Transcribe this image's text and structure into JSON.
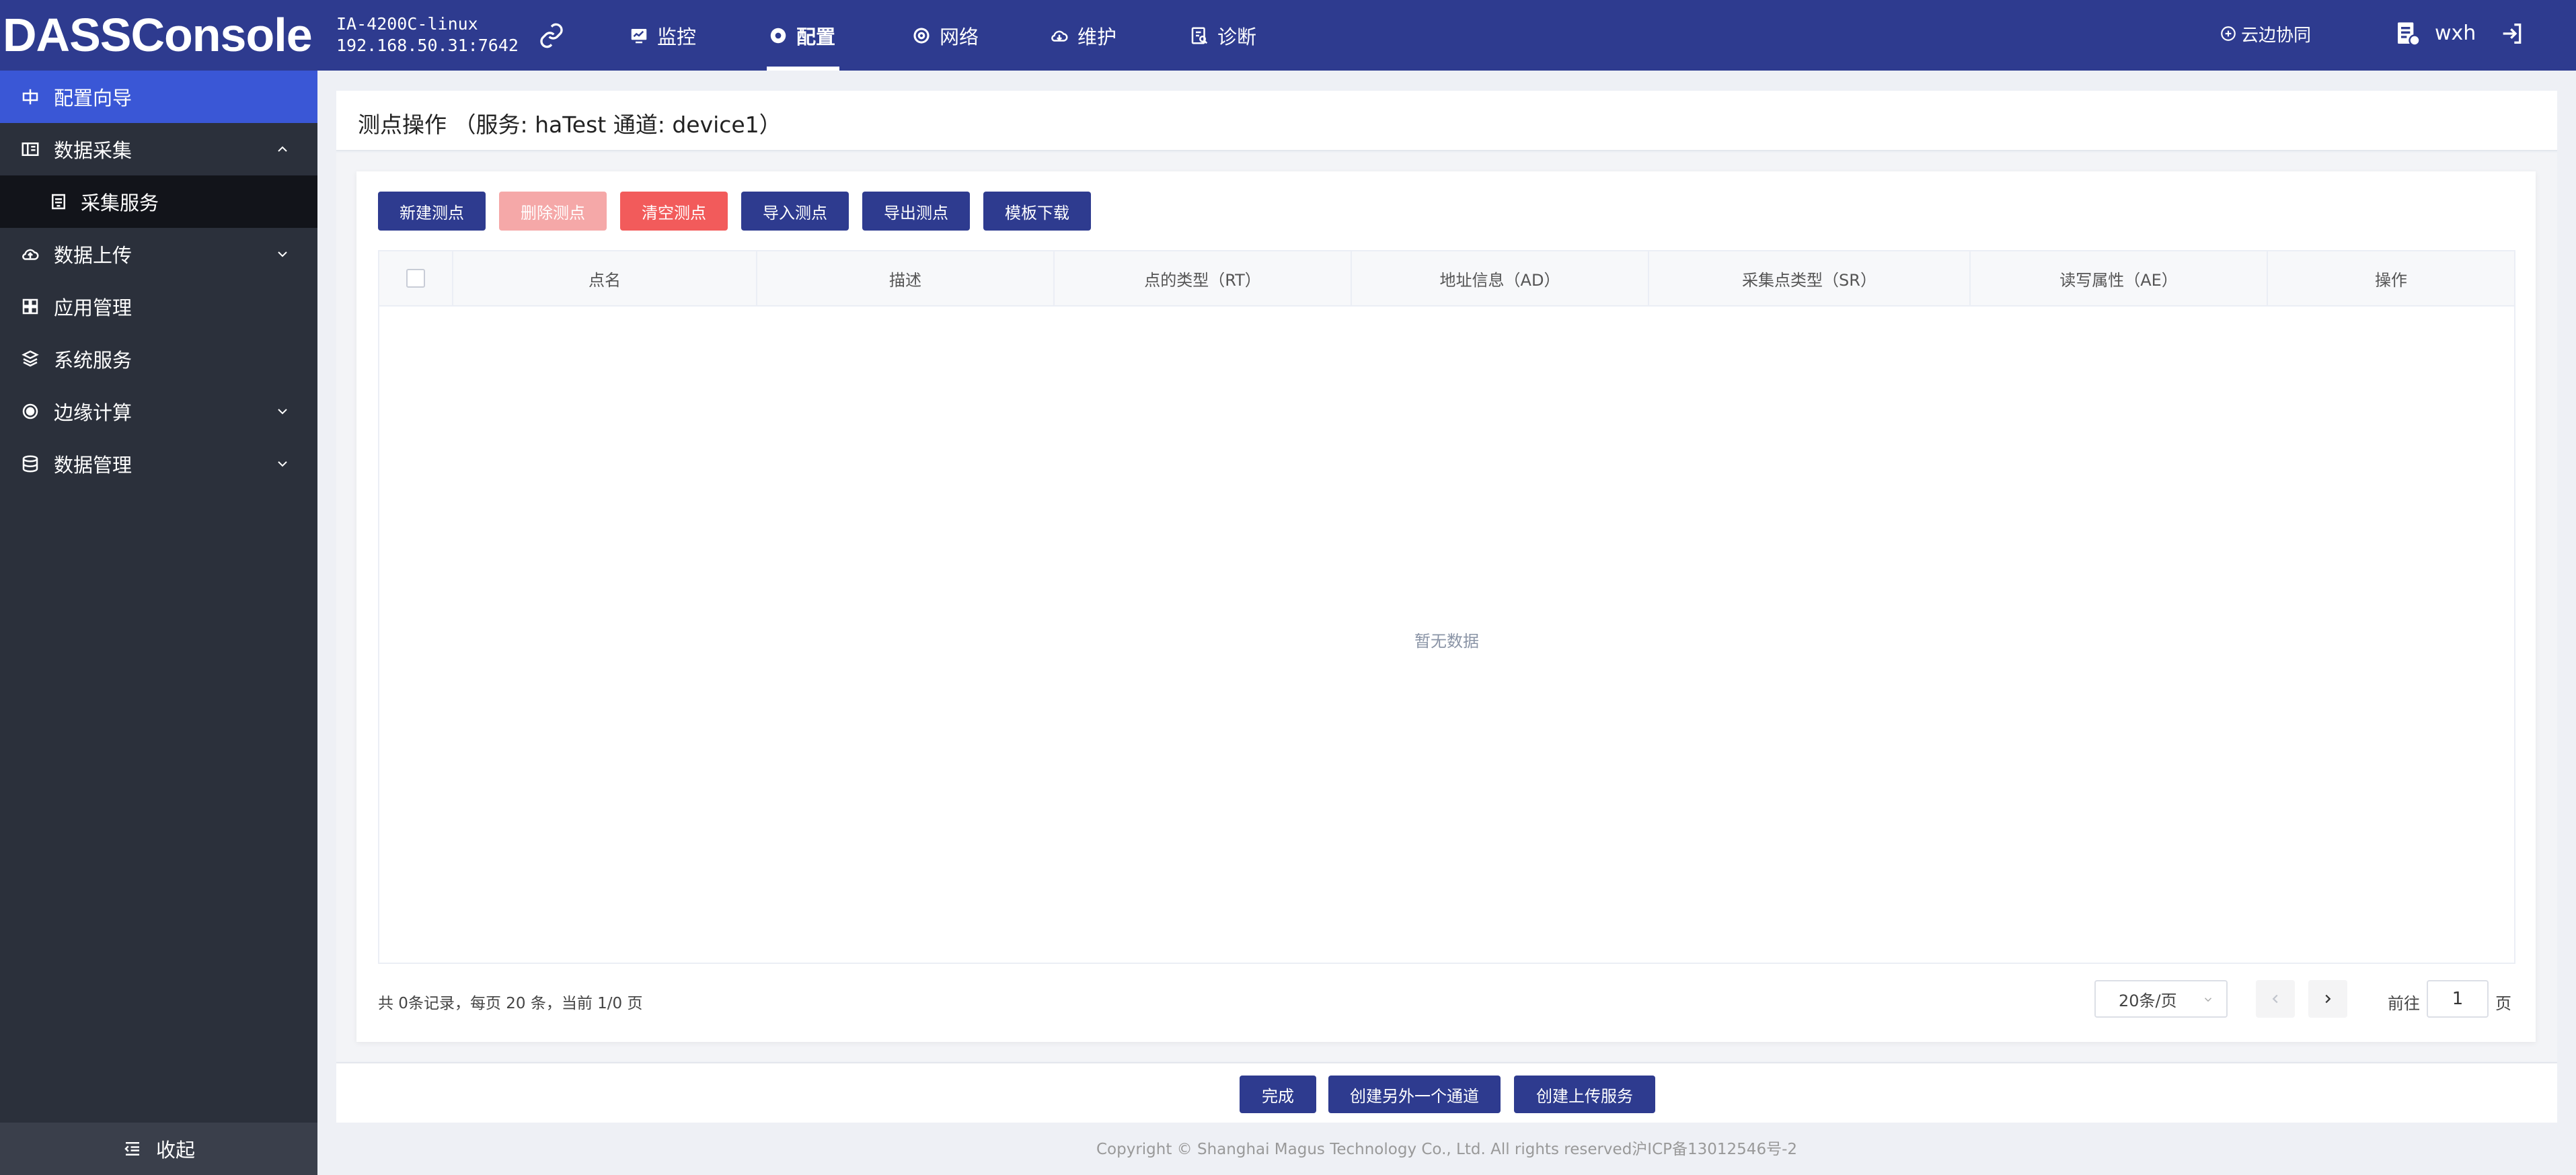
{
  "header": {
    "logo": "DASSConsole",
    "device_name": "IA-4200C-linux",
    "device_ip": "192.168.50.31:7642",
    "nav": [
      {
        "label": "监控",
        "icon": "monitor-icon"
      },
      {
        "label": "配置",
        "icon": "gear-icon"
      },
      {
        "label": "网络",
        "icon": "network-icon"
      },
      {
        "label": "维护",
        "icon": "cloud-icon"
      },
      {
        "label": "诊断",
        "icon": "diagnose-icon"
      }
    ],
    "active_nav": "配置",
    "cloud_collab": "云边协同",
    "username": "wxh"
  },
  "sidebar": {
    "items": [
      {
        "label": "配置向导",
        "icon": "wizard-icon"
      },
      {
        "label": "数据采集",
        "icon": "collect-icon"
      },
      {
        "label": "采集服务",
        "icon": "service-icon"
      },
      {
        "label": "数据上传",
        "icon": "upload-icon"
      },
      {
        "label": "应用管理",
        "icon": "apps-icon"
      },
      {
        "label": "系统服务",
        "icon": "system-icon"
      },
      {
        "label": "边缘计算",
        "icon": "edge-icon"
      },
      {
        "label": "数据管理",
        "icon": "database-icon"
      }
    ],
    "collapse_label": "收起"
  },
  "page": {
    "title": "测点操作 （服务: haTest 通道: device1）"
  },
  "toolbar": {
    "new_point": "新建测点",
    "delete_point": "删除测点",
    "clear_points": "清空测点",
    "import_points": "导入测点",
    "export_points": "导出测点",
    "template_download": "模板下载"
  },
  "table": {
    "columns": [
      "点名",
      "描述",
      "点的类型（RT）",
      "地址信息（AD）",
      "采集点类型（SR）",
      "读写属性（AE）",
      "操作"
    ],
    "rows": [],
    "empty_text": "暂无数据"
  },
  "pagination": {
    "summary": "共 0条记录，每页 20 条，当前 1/0 页",
    "page_size": "20条/页",
    "goto_label": "前往",
    "goto_value": "1",
    "page_suffix": "页"
  },
  "footer": {
    "finish": "完成",
    "create_channel": "创建另外一个通道",
    "create_upload": "创建上传服务",
    "copyright": "Copyright © Shanghai Magus Technology Co., Ltd. All rights reserved沪ICP备13012546号-2"
  },
  "colors": {
    "header_bg": "#2e3b8f",
    "sidebar_bg": "#2b303b",
    "sidebar_active": "#3a57d6",
    "danger": "#f25b5b",
    "danger_disabled": "#f5a8a8"
  }
}
